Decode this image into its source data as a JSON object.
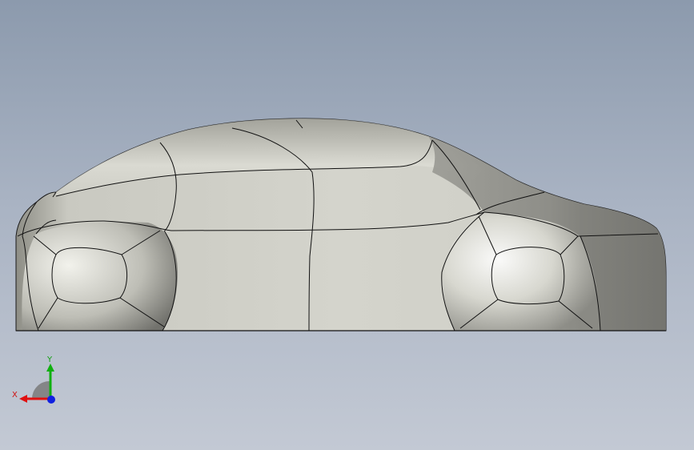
{
  "viewport": {
    "background_top": "#8c9aad",
    "background_bottom": "#c3c9d4"
  },
  "model": {
    "icon": "car-body-surface-model",
    "shading": "shaded-with-edges",
    "color": "#c8c8c0",
    "edge_color": "#000000"
  },
  "triad": {
    "icon": "coordinate-axes-triad",
    "x_label": "X",
    "y_label": "Y",
    "x_color": "#e01010",
    "y_color": "#10b010",
    "z_color": "#1020e0"
  }
}
